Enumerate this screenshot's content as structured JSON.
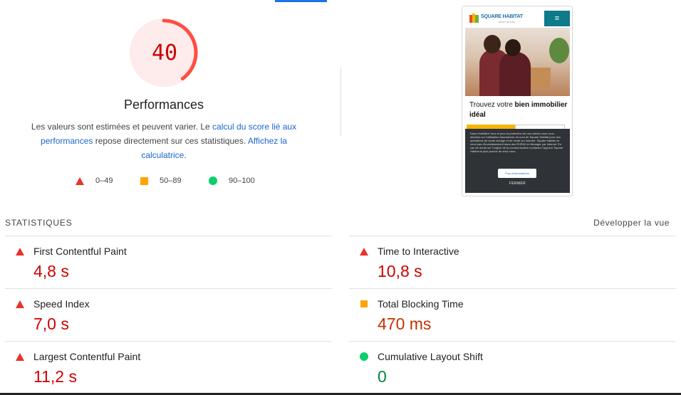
{
  "gauge": {
    "score": "40",
    "fraction": 0.4,
    "color": "#ff4e42",
    "bg": "#fdeceb",
    "label": "Performances"
  },
  "description": {
    "part1": "Les valeurs sont estimées et peuvent varier. Le ",
    "link1": "calcul du score lié aux performances",
    "part2": " repose directement sur ces statistiques. ",
    "link2": "Affichez la calculatrice",
    "part3": "."
  },
  "legend": [
    {
      "icon": "triangle-icon",
      "label": "0–49",
      "color": "#e8332b"
    },
    {
      "icon": "square-icon",
      "label": "50–89",
      "color": "#ffa400"
    },
    {
      "icon": "circle-icon",
      "label": "90–100",
      "color": "#0cce6b"
    }
  ],
  "preview": {
    "brand": "SQUARE HABITAT",
    "brand_sub": "CRÉDIT MUTUEL",
    "hero_title_plain": "Trouvez votre ",
    "hero_title_bold": "bien immobilier idéal",
    "cookie_text": "Dans l'habitat.fr tous et pour la protection de nos clients nous vous alertons sur l'utilisation frauduleuse du nom de Square Habitat pour des opérations de vente achage et de vente sur internet. Square habitat ne vend pas d'investissement dans des EHPAD à l'étranger par internet. En cas de doute sur l'origine de la communication contactez l'agence Square Habitat la plus proche de chez vous.",
    "more_button": "Plus d'informations",
    "close_button": "FERMER"
  },
  "stats": {
    "title": "STATISTIQUES",
    "expand": "Développer la vue",
    "metrics": [
      {
        "label": "First Contentful Paint",
        "value": "4,8 s",
        "rating": "bad",
        "icon": "triangle-icon"
      },
      {
        "label": "Time to Interactive",
        "value": "10,8 s",
        "rating": "bad",
        "icon": "triangle-icon"
      },
      {
        "label": "Speed Index",
        "value": "7,0 s",
        "rating": "bad",
        "icon": "triangle-icon"
      },
      {
        "label": "Total Blocking Time",
        "value": "470 ms",
        "rating": "average",
        "icon": "square-icon"
      },
      {
        "label": "Largest Contentful Paint",
        "value": "11,2 s",
        "rating": "bad",
        "icon": "triangle-icon"
      },
      {
        "label": "Cumulative Layout Shift",
        "value": "0",
        "rating": "good",
        "icon": "circle-icon"
      }
    ]
  }
}
